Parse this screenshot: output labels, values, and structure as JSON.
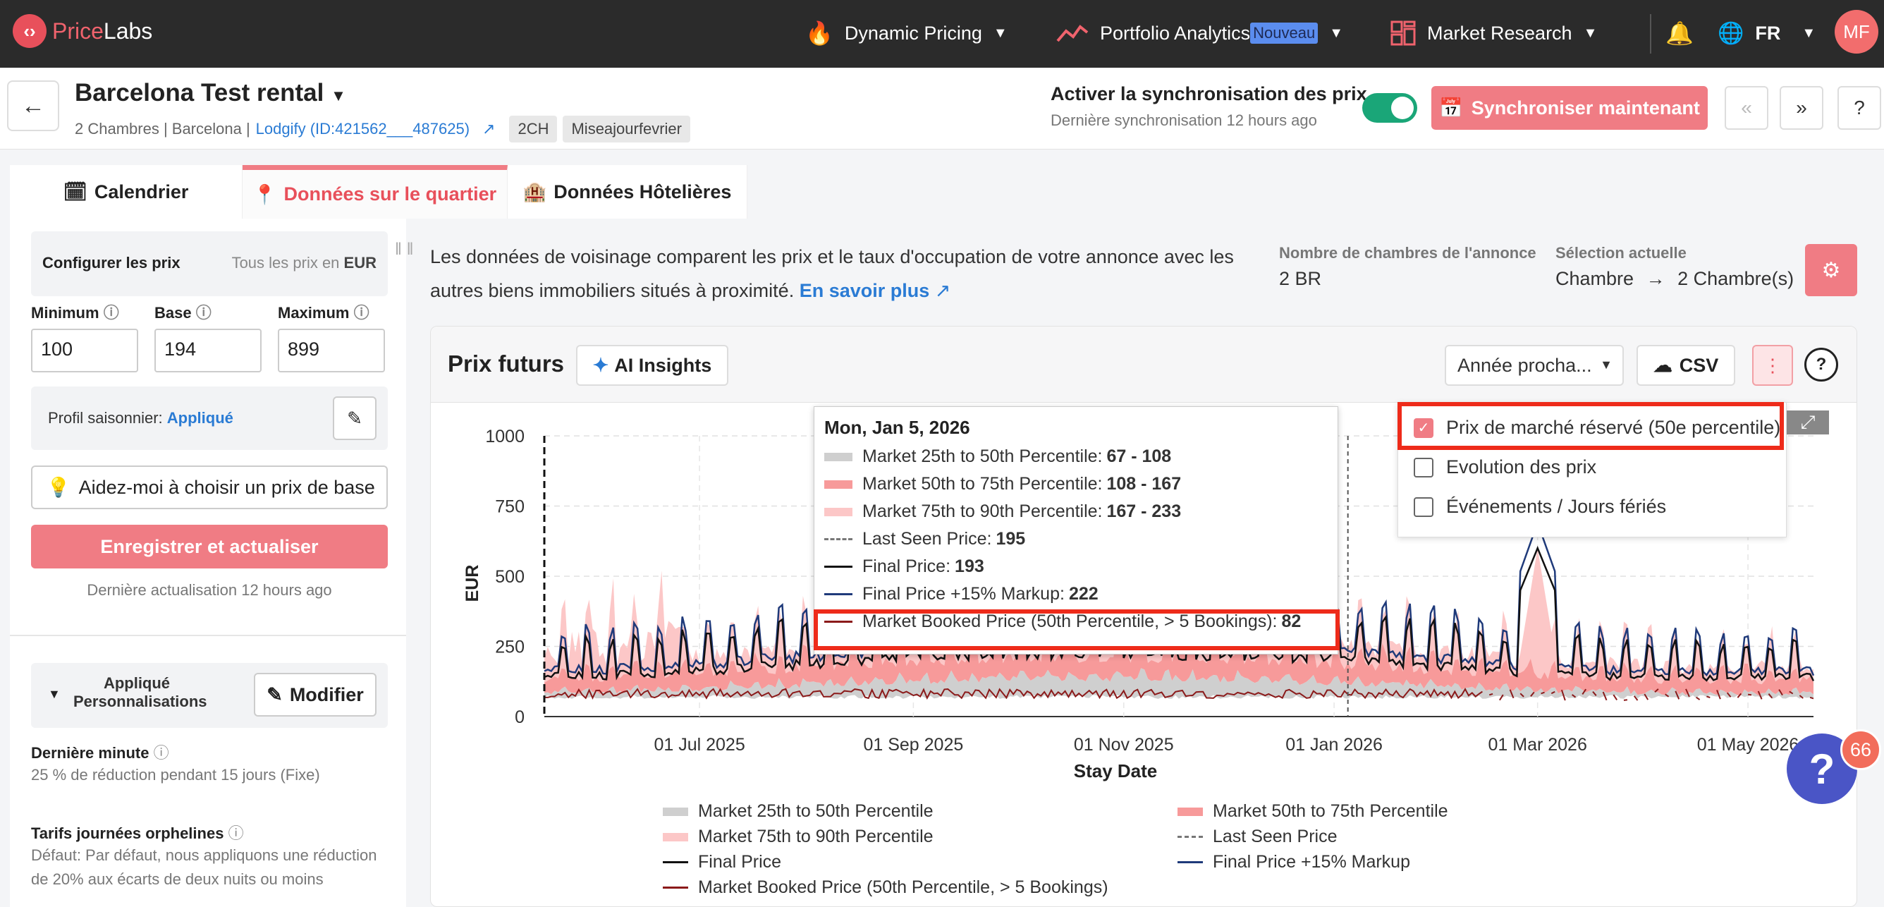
{
  "topnav": {
    "logo_price": "Price",
    "logo_labs": "Labs",
    "items": [
      {
        "label": "Dynamic Pricing",
        "icon": "flame-icon"
      },
      {
        "label": "Portfolio Analytics",
        "badge": "Nouveau",
        "icon": "trend-icon"
      },
      {
        "label": "Market Research",
        "icon": "grid-icon"
      }
    ],
    "lang": "FR",
    "avatar": "MF"
  },
  "header": {
    "title": "Barcelona Test rental",
    "subtitle": "2 Chambres | Barcelona |",
    "lodgify": "Lodgify (ID:421562___487625)",
    "tags": [
      "2CH",
      "Miseajourfevrier"
    ],
    "sync_label": "Activer la synchronisation des prix",
    "sync_sub": "Dernière synchronisation 12 hours ago",
    "sync_button": "Synchroniser maintenant"
  },
  "tabs": [
    {
      "label": "Calendrier"
    },
    {
      "label": "Données sur le quartier"
    },
    {
      "label": "Données Hôtelières"
    }
  ],
  "left": {
    "cfg_title": "Configurer les prix",
    "cfg_currency_prefix": "Tous les prix en",
    "cfg_currency": "EUR",
    "min_label": "Minimum",
    "base_label": "Base",
    "max_label": "Maximum",
    "min_value": "100",
    "base_value": "194",
    "max_value": "899",
    "profile_label": "Profil saisonnier:",
    "profile_value": "Appliqué",
    "help_button": "Aidez-moi à choisir un prix de base",
    "save_button": "Enregistrer et actualiser",
    "last_update": "Dernière actualisation 12 hours ago",
    "applied_label": "Appliqué Personnalisations",
    "modify_button": "Modifier",
    "last_minute_label": "Dernière minute",
    "last_minute_text": "25 % de réduction pendant 15 jours (Fixe)",
    "orphan_label": "Tarifs journées orphelines",
    "orphan_text": "Défaut: Par défaut, nous appliquons une réduction de 20% aux écarts de deux nuits ou moins"
  },
  "main": {
    "info_text": "Les données de voisinage comparent les prix et le taux d'occupation de votre annonce avec les autres biens immobiliers situés à proximité.",
    "learn_more": "En savoir plus",
    "rooms_label": "Nombre de chambres de l'annonce",
    "rooms_value": "2 BR",
    "selection_label": "Sélection actuelle",
    "selection_from": "Chambre",
    "selection_to": "2 Chambre(s)"
  },
  "card": {
    "title": "Prix futurs",
    "ai_button": "AI Insights",
    "year_select": "Année procha...",
    "csv_button": "CSV"
  },
  "options": [
    {
      "label": "Prix de marché réservé (50e percentile)",
      "checked": true
    },
    {
      "label": "Evolution des prix",
      "checked": false
    },
    {
      "label": "Événements / Jours fériés",
      "checked": false
    }
  ],
  "tooltip": {
    "date": "Mon, Jan 5, 2026",
    "rows": [
      {
        "label": "Market 25th to 50th Percentile:",
        "value": "67 - 108",
        "color": "#cfcfcf",
        "style": "band"
      },
      {
        "label": "Market 50th to 75th Percentile:",
        "value": "108 - 167",
        "color": "#f79a9a",
        "style": "band"
      },
      {
        "label": "Market 75th to 90th Percentile:",
        "value": "167 - 233",
        "color": "#fcc7c7",
        "style": "band"
      },
      {
        "label": "Last Seen Price:",
        "value": "195",
        "color": "#777777",
        "style": "dash"
      },
      {
        "label": "Final Price:",
        "value": "193",
        "color": "#111111",
        "style": "line"
      },
      {
        "label": "Final Price +15% Markup:",
        "value": "222",
        "color": "#1f3a7a",
        "style": "line"
      },
      {
        "label": "Market Booked Price (50th Percentile, > 5 Bookings):",
        "value": "82",
        "color": "#8b1a1a",
        "style": "line"
      }
    ]
  },
  "chart_data": {
    "type": "area",
    "xlabel": "Stay Date",
    "ylabel": "EUR",
    "ylim": [
      0,
      1000
    ],
    "yticks": [
      "0",
      "250",
      "500",
      "750",
      "1000"
    ],
    "xticks": [
      "01 Jul 2025",
      "01 Sep 2025",
      "01 Nov 2025",
      "01 Jan 2026",
      "01 Mar 2026",
      "01 May 2026"
    ],
    "x_range": [
      "2025-05-17",
      "2026-05-20"
    ],
    "hover_date": "2026-01-05",
    "series": [
      {
        "name": "Market 25th to 50th Percentile",
        "color": "#cfcfcf"
      },
      {
        "name": "Market 50th to 75th Percentile",
        "color": "#f79a9a"
      },
      {
        "name": "Market 75th to 90th Percentile",
        "color": "#fcc7c7"
      },
      {
        "name": "Last Seen Price",
        "color": "#777777"
      },
      {
        "name": "Final Price",
        "color": "#111111"
      },
      {
        "name": "Final Price +15% Markup",
        "color": "#1f3a7a"
      },
      {
        "name": "Market Booked Price (50th Percentile, > 5 Bookings)",
        "color": "#8b1a1a"
      }
    ],
    "p25": 70,
    "p50": 110,
    "p75": 170,
    "p90": 235,
    "final_price_base": 193,
    "final_price_peak": 420,
    "markup_pct": 15,
    "booked_median": 82,
    "march_spike": 600,
    "legend": [
      "Market 25th to 50th Percentile",
      "Market 50th to 75th Percentile",
      "Market 75th to 90th Percentile",
      "Last Seen Price",
      "Final Price",
      "Final Price +15% Markup",
      "Market Booked Price (50th Percentile, > 5 Bookings)"
    ]
  },
  "help": {
    "bubble": "?",
    "count": "66"
  }
}
